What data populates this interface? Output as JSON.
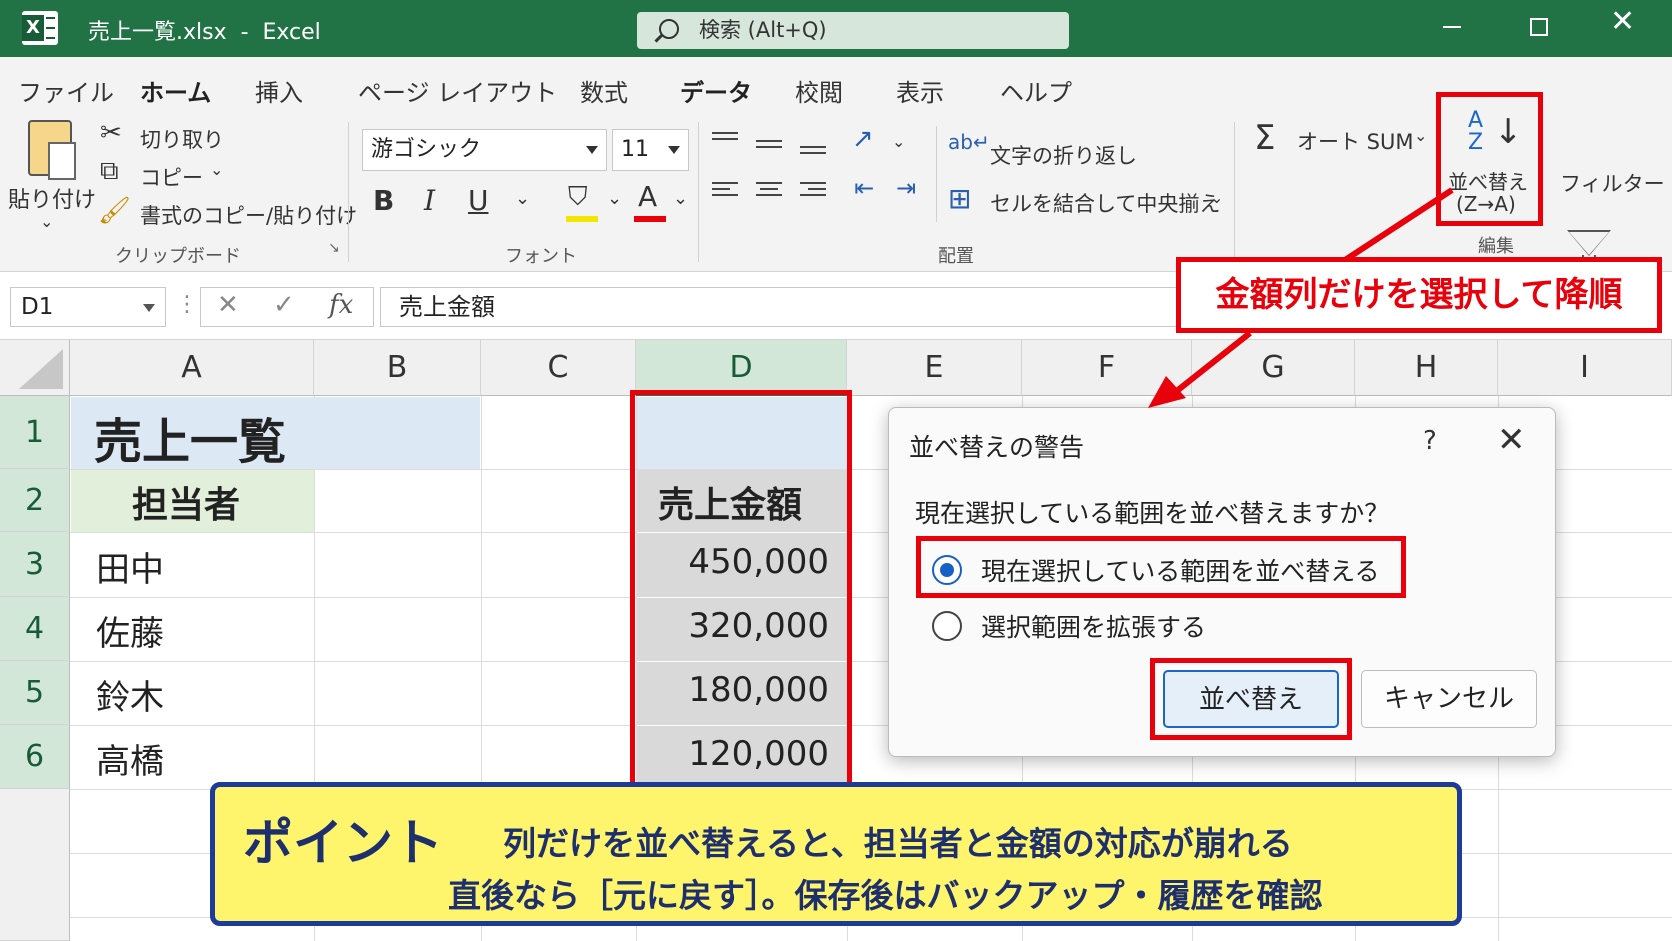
{
  "window": {
    "title": "売上一覧.xlsx  -  Excel",
    "search_text": "検索 (Alt+Q)",
    "close_glyph": "✕"
  },
  "tabs": [
    {
      "label": "ファイル"
    },
    {
      "label": "ホーム",
      "active": true
    },
    {
      "label": "挿入"
    },
    {
      "label": "ページ レイアウト"
    },
    {
      "label": "数式"
    },
    {
      "label": "データ",
      "active": true
    },
    {
      "label": "校閲"
    },
    {
      "label": "表示"
    },
    {
      "label": "ヘルプ"
    }
  ],
  "ribbon": {
    "clipboard": {
      "paste": "貼り付け",
      "cut": "切り取り",
      "copy": "コピー",
      "format_painter": "書式のコピー/貼り付け",
      "group_label": "クリップボード"
    },
    "font": {
      "font_name": "游ゴシック",
      "font_size": "11",
      "bold": "B",
      "italic": "I",
      "underline": "U",
      "font_color_glyph": "A",
      "group_label": "フォント"
    },
    "alignment": {
      "wrap_text": "文字の折り返し",
      "merge_center": "セルを結合して中央揃え",
      "group_label": "配置"
    },
    "editing": {
      "autosum_glyph": "Σ",
      "autosum": "オート SUM",
      "sort_icon_top": "A",
      "sort_icon_bottom": "Z",
      "sort_label": "並べ替え",
      "sort_sub": "(Z→A)",
      "filter": "フィルター",
      "group_label": "編集"
    }
  },
  "formula_bar": {
    "name_box": "D1",
    "cancel_glyph": "✕",
    "enter_glyph": "✓",
    "fx_label": "fx",
    "content": "売上金額"
  },
  "sheet": {
    "columns": [
      "A",
      "B",
      "C",
      "D",
      "E",
      "F",
      "G",
      "H",
      "I"
    ],
    "rows": [
      "1",
      "2",
      "3",
      "4",
      "5",
      "6"
    ],
    "title": "売上一覧",
    "header_person": "担当者",
    "header_amount": "売上金額",
    "persons": [
      "田中",
      "佐藤",
      "鈴木",
      "高橋"
    ],
    "amounts": [
      "450,000",
      "320,000",
      "180,000",
      "120,000"
    ]
  },
  "dialog": {
    "title": "並べ替えの警告",
    "help": "?",
    "close": "✕",
    "question": "現在選択している範囲を並べ替えますか？",
    "option_current": "現在選択している範囲を並べ替える",
    "option_expand": "選択範囲を拡張する",
    "sort_button": "並べ替え",
    "cancel_button": "キャンセル"
  },
  "callout": {
    "text": "金額列だけを選択して降順"
  },
  "point": {
    "title": "ポイント",
    "line1": "列だけを並べ替えると、担当者と金額の対応が崩れる",
    "line2": "直後なら［元に戻す］。保存後はバックアップ・履歴を確認"
  },
  "colors": {
    "excel_green": "#217346",
    "highlight_red": "#e8000b",
    "point_yellow": "#fff56d",
    "point_navy": "#1d3b99"
  }
}
